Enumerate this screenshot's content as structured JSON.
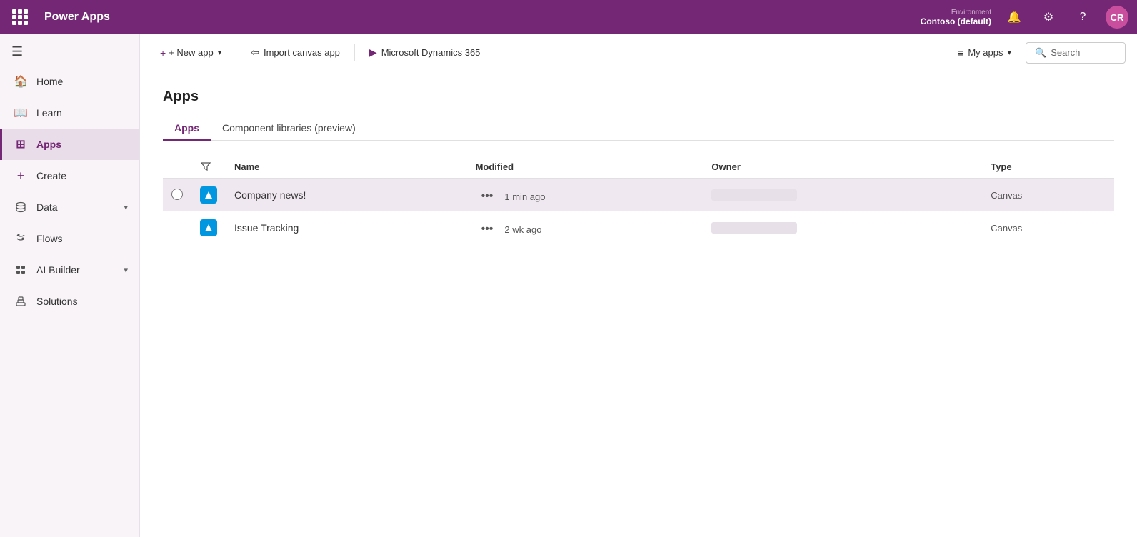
{
  "app": {
    "title": "Power Apps",
    "avatar_initials": "CR",
    "environment_label": "Environment",
    "environment_name": "Contoso (default)"
  },
  "topbar": {
    "waffle_label": "Apps grid",
    "notifications_label": "Notifications",
    "settings_label": "Settings",
    "help_label": "Help"
  },
  "sidebar": {
    "collapse_label": "Collapse navigation",
    "items": [
      {
        "id": "home",
        "label": "Home",
        "icon": "🏠"
      },
      {
        "id": "learn",
        "label": "Learn",
        "icon": "📖"
      },
      {
        "id": "apps",
        "label": "Apps",
        "icon": "⊞",
        "active": true
      },
      {
        "id": "create",
        "label": "Create",
        "icon": "+"
      },
      {
        "id": "data",
        "label": "Data",
        "icon": "🗄",
        "has_chevron": true
      },
      {
        "id": "flows",
        "label": "Flows",
        "icon": "↻"
      },
      {
        "id": "ai-builder",
        "label": "AI Builder",
        "icon": "🤖",
        "has_chevron": true
      },
      {
        "id": "solutions",
        "label": "Solutions",
        "icon": "🔧"
      }
    ]
  },
  "toolbar": {
    "new_app_label": "+ New app",
    "new_app_chevron": "▾",
    "import_canvas_label": "Import canvas app",
    "microsoft_dynamics_label": "Microsoft Dynamics 365",
    "my_apps_label": "My apps",
    "my_apps_chevron": "▾",
    "search_placeholder": "Search"
  },
  "page": {
    "title": "Apps",
    "tabs": [
      {
        "id": "apps",
        "label": "Apps",
        "active": true
      },
      {
        "id": "component-libraries",
        "label": "Component libraries (preview)",
        "active": false
      }
    ]
  },
  "table": {
    "columns": [
      {
        "id": "check",
        "label": ""
      },
      {
        "id": "icon",
        "label": ""
      },
      {
        "id": "name",
        "label": "Name"
      },
      {
        "id": "modified",
        "label": "Modified"
      },
      {
        "id": "owner",
        "label": "Owner"
      },
      {
        "id": "type",
        "label": "Type"
      }
    ],
    "rows": [
      {
        "id": "company-news",
        "name": "Company news!",
        "modified": "1 min ago",
        "type": "Canvas",
        "highlighted": true
      },
      {
        "id": "issue-tracking",
        "name": "Issue Tracking",
        "modified": "2 wk ago",
        "type": "Canvas",
        "highlighted": false
      }
    ]
  }
}
